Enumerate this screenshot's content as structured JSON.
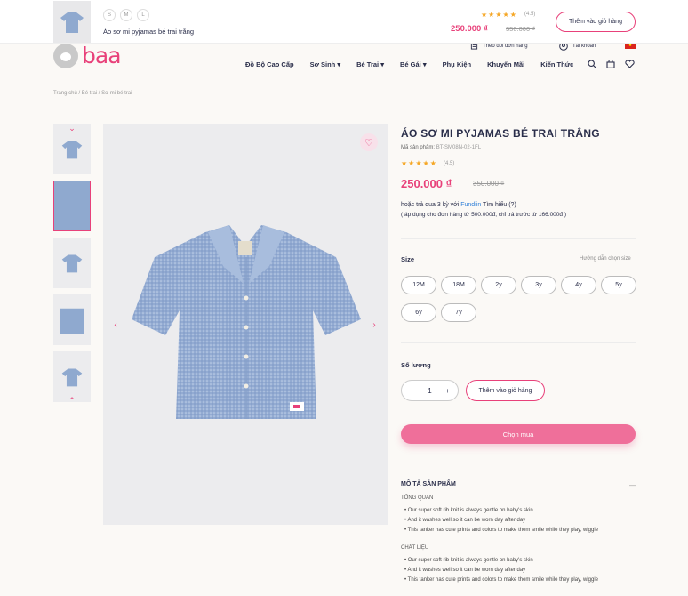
{
  "sticky": {
    "sizes": [
      "S",
      "M",
      "L"
    ],
    "name": "Áo sơ mi pyjamas bé trai trắng",
    "stars": "★★★★★",
    "rating": "(4.5)",
    "price": "250.000 ₫",
    "old_price": "350.000 ₫",
    "add_to_cart": "Thêm vào giỏ hàng"
  },
  "header": {
    "logo": "baa",
    "track_order": "Theo dõi đơn hàng",
    "account": "Tài khoản",
    "nav": [
      "Đồ Bộ Cao Cấp",
      "Sơ Sinh ▾",
      "Bé Trai ▾",
      "Bé Gái ▾",
      "Phụ Kiện",
      "Khuyến Mãi",
      "Kiến Thức"
    ]
  },
  "breadcrumb": "Trang chủ  /  Bé trai  /  Sơ mi bé trai",
  "product": {
    "title": "ÁO SƠ MI PYJAMAS BÉ TRAI TRẮNG",
    "sku_label": "Mã sản phẩm:",
    "sku": "BT-SM08N-02-1FL",
    "stars": "★★★★★",
    "rating": "(4.5)",
    "price": "250.000 ₫",
    "old_price": "350.000 ₫",
    "installment": "hoặc trả qua 3 kỳ với",
    "fundiin": "Fundiin",
    "learn": "Tìm hiểu (?)",
    "installment_note": "( áp dụng cho đơn hàng từ 500.000đ, chỉ trả trước từ 166.000đ )",
    "size_label": "Size",
    "size_guide": "Hướng dẫn chọn size",
    "sizes": [
      "12M",
      "18M",
      "2y",
      "3y",
      "4y",
      "5y",
      "6y",
      "7y"
    ],
    "qty_label": "Số lượng",
    "qty": "1",
    "add_to_cart": "Thêm vào giỏ hàng",
    "buy_now": "Chọn mua"
  },
  "description": {
    "heading": "MÔ TẢ SẢN PHẨM",
    "overview_label": "TỔNG QUAN",
    "overview": [
      "Our super soft rib knit is always gentle on baby's skin",
      "And it washes well so it can be worn day after day",
      "This tanker has cute prints and colors to make them smile while they play, wiggle"
    ],
    "material_label": "CHẤT LIỆU",
    "material": [
      "Our super soft rib knit is always gentle on baby's skin",
      "And it washes well so it can be worn day after day",
      "This tanker has cute prints and colors to make them smile while they play, wiggle"
    ]
  }
}
